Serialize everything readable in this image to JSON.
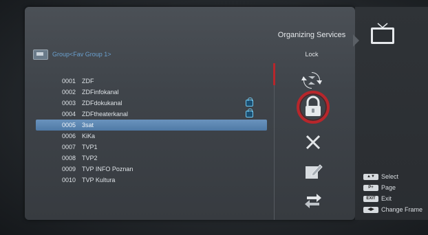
{
  "screen": {
    "title": "Organizing Services"
  },
  "group": {
    "label": "Group<Fav Group 1>"
  },
  "mode": {
    "label": "Lock"
  },
  "channels": [
    {
      "num": "0001",
      "name": "ZDF",
      "locked": false,
      "selected": false
    },
    {
      "num": "0002",
      "name": "ZDFinfokanal",
      "locked": false,
      "selected": false
    },
    {
      "num": "0003",
      "name": "ZDFdokukanal",
      "locked": true,
      "selected": false
    },
    {
      "num": "0004",
      "name": "ZDFtheaterkanal",
      "locked": true,
      "selected": false
    },
    {
      "num": "0005",
      "name": "3sat",
      "locked": false,
      "selected": true
    },
    {
      "num": "0006",
      "name": "KiKa",
      "locked": false,
      "selected": false
    },
    {
      "num": "0007",
      "name": "TVP1",
      "locked": false,
      "selected": false
    },
    {
      "num": "0008",
      "name": "TVP2",
      "locked": false,
      "selected": false
    },
    {
      "num": "0009",
      "name": "TVP INFO Poznan",
      "locked": false,
      "selected": false
    },
    {
      "num": "0010",
      "name": "TVP Kultura",
      "locked": false,
      "selected": false
    }
  ],
  "actions": [
    {
      "name": "move-icon",
      "active": false
    },
    {
      "name": "lock-icon",
      "active": true
    },
    {
      "name": "delete-icon",
      "active": false
    },
    {
      "name": "rename-icon",
      "active": false
    },
    {
      "name": "sort-icon",
      "active": false
    }
  ],
  "hints": [
    {
      "key": "▲▼",
      "label": "Select"
    },
    {
      "key": "P+",
      "label": "Page"
    },
    {
      "key": "EXIT",
      "label": "Exit"
    },
    {
      "key": "◀▶",
      "label": "Change Frame"
    }
  ],
  "colors": {
    "highlight": "#5a86b2",
    "group_text": "#6aa0cf",
    "lock_ring": "#b8262b"
  }
}
